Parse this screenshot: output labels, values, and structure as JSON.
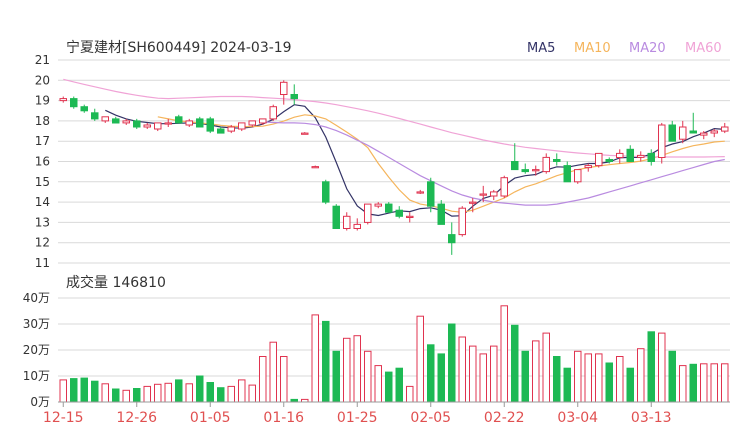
{
  "header": {
    "title": "宁夏建材[SH600449] 2024-03-19",
    "ma_legend": [
      {
        "label": "MA5",
        "color": "#333366"
      },
      {
        "label": "MA10",
        "color": "#f5b55c"
      },
      {
        "label": "MA20",
        "color": "#b98be0"
      },
      {
        "label": "MA60",
        "color": "#f0a3d6"
      }
    ]
  },
  "volume_panel": {
    "label": "成交量 146810"
  },
  "colors": {
    "up": "#e0334f",
    "down": "#1db954",
    "grid": "#d9d9d9",
    "axis_text": "#333333",
    "date_text": "#e05050"
  },
  "chart_data": [
    {
      "type": "candlestick",
      "title": "宁夏建材[SH600449] 2024-03-19",
      "ylim": [
        11,
        21
      ],
      "yticks": [
        "11",
        "12",
        "13",
        "14",
        "15",
        "16",
        "17",
        "18",
        "19",
        "20",
        "21"
      ],
      "x_tick_labels": [
        "12-15",
        "12-26",
        "01-05",
        "01-16",
        "01-25",
        "02-05",
        "02-22",
        "03-04",
        "03-13"
      ],
      "x_tick_index": [
        0,
        7,
        14,
        21,
        28,
        35,
        42,
        49,
        56
      ],
      "ohlc": [
        [
          19.0,
          19.2,
          18.9,
          19.1
        ],
        [
          19.1,
          19.2,
          18.6,
          18.7
        ],
        [
          18.7,
          18.8,
          18.4,
          18.5
        ],
        [
          18.4,
          18.6,
          18.0,
          18.1
        ],
        [
          18.0,
          18.2,
          17.9,
          18.2
        ],
        [
          18.1,
          18.2,
          17.9,
          17.9
        ],
        [
          17.9,
          18.1,
          17.8,
          18.0
        ],
        [
          18.0,
          18.1,
          17.6,
          17.7
        ],
        [
          17.7,
          17.9,
          17.6,
          17.8
        ],
        [
          17.6,
          17.9,
          17.5,
          17.9
        ],
        [
          17.9,
          18.1,
          17.7,
          17.9
        ],
        [
          18.2,
          18.3,
          17.9,
          17.9
        ],
        [
          17.8,
          18.1,
          17.7,
          18.0
        ],
        [
          18.1,
          18.2,
          17.7,
          17.7
        ],
        [
          18.1,
          18.2,
          17.4,
          17.5
        ],
        [
          17.6,
          17.7,
          17.4,
          17.4
        ],
        [
          17.5,
          17.8,
          17.4,
          17.7
        ],
        [
          17.6,
          17.9,
          17.5,
          17.9
        ],
        [
          17.8,
          18.0,
          17.7,
          18.0
        ],
        [
          17.9,
          18.1,
          17.8,
          18.1
        ],
        [
          18.1,
          18.8,
          18.0,
          18.7
        ],
        [
          19.3,
          20.0,
          18.8,
          19.9
        ],
        [
          19.3,
          19.8,
          18.8,
          19.1
        ],
        [
          17.4,
          17.45,
          17.35,
          17.4
        ],
        [
          15.75,
          15.8,
          15.7,
          15.75
        ],
        [
          15.0,
          15.1,
          13.9,
          14.0
        ],
        [
          13.8,
          13.9,
          12.7,
          12.7
        ],
        [
          12.7,
          13.5,
          12.6,
          13.3
        ],
        [
          12.7,
          13.2,
          12.6,
          12.9
        ],
        [
          13.0,
          13.9,
          12.9,
          13.9
        ],
        [
          13.8,
          14.0,
          13.7,
          13.9
        ],
        [
          13.9,
          14.0,
          13.5,
          13.5
        ],
        [
          13.6,
          13.8,
          13.2,
          13.3
        ],
        [
          13.3,
          13.5,
          13.0,
          13.3
        ],
        [
          14.5,
          14.6,
          14.4,
          14.5
        ],
        [
          15.0,
          15.2,
          13.5,
          13.8
        ],
        [
          13.9,
          14.1,
          12.9,
          12.9
        ],
        [
          12.4,
          13.0,
          11.4,
          12.0
        ],
        [
          12.4,
          13.8,
          12.3,
          13.7
        ],
        [
          14.0,
          14.2,
          13.5,
          14.0
        ],
        [
          14.4,
          14.8,
          14.0,
          14.4
        ],
        [
          14.3,
          14.6,
          14.1,
          14.5
        ],
        [
          14.3,
          15.3,
          14.2,
          15.2
        ],
        [
          16.0,
          16.9,
          15.7,
          15.6
        ],
        [
          15.6,
          15.9,
          15.4,
          15.5
        ],
        [
          15.6,
          15.8,
          15.3,
          15.6
        ],
        [
          15.5,
          16.4,
          15.4,
          16.2
        ],
        [
          16.1,
          16.4,
          15.8,
          16.0
        ],
        [
          15.8,
          16.0,
          15.0,
          15.0
        ],
        [
          15.0,
          15.3,
          14.9,
          15.6
        ],
        [
          15.7,
          15.9,
          15.5,
          15.8
        ],
        [
          15.8,
          16.4,
          15.7,
          16.4
        ],
        [
          16.1,
          16.2,
          15.9,
          16.0
        ],
        [
          16.2,
          16.6,
          15.9,
          16.4
        ],
        [
          16.6,
          16.8,
          16.1,
          16.0
        ],
        [
          16.2,
          16.5,
          16.0,
          16.3
        ],
        [
          16.4,
          16.6,
          15.8,
          16.0
        ],
        [
          16.2,
          17.9,
          15.9,
          17.8
        ],
        [
          17.8,
          18.0,
          17.1,
          17.0
        ],
        [
          17.1,
          18.0,
          16.9,
          17.7
        ],
        [
          17.5,
          18.4,
          17.4,
          17.4
        ],
        [
          17.3,
          17.5,
          17.1,
          17.4
        ],
        [
          17.4,
          17.6,
          17.2,
          17.5
        ],
        [
          17.5,
          17.9,
          17.4,
          17.7
        ]
      ],
      "ma_series": [
        {
          "name": "MA5",
          "values": [
            null,
            null,
            null,
            null,
            18.52,
            18.28,
            18.1,
            17.98,
            17.92,
            17.86,
            17.86,
            17.88,
            17.9,
            17.88,
            17.8,
            17.7,
            17.66,
            17.64,
            17.7,
            17.84,
            18.08,
            18.46,
            18.8,
            18.72,
            18.16,
            17.2,
            15.95,
            14.65,
            13.81,
            13.42,
            13.34,
            13.46,
            13.57,
            13.53,
            13.68,
            13.72,
            13.6,
            13.31,
            13.33,
            13.8,
            14.18,
            14.34,
            14.82,
            15.18,
            15.3,
            15.36,
            15.58,
            15.74,
            15.72,
            15.82,
            15.9,
            15.9,
            15.98,
            16.18,
            16.2,
            16.2,
            16.37,
            16.68,
            16.86,
            16.98,
            17.22,
            17.4,
            17.62,
            17.58
          ]
        },
        {
          "name": "MA10",
          "values": [
            null,
            null,
            null,
            null,
            null,
            null,
            null,
            null,
            null,
            18.2,
            18.1,
            18.0,
            17.95,
            17.9,
            17.85,
            17.78,
            17.74,
            17.72,
            17.72,
            17.74,
            17.84,
            17.99,
            18.18,
            18.3,
            18.24,
            18.1,
            17.78,
            17.45,
            17.1,
            16.68,
            15.9,
            15.22,
            14.6,
            14.1,
            13.9,
            13.82,
            13.7,
            13.55,
            13.5,
            13.6,
            13.8,
            14.0,
            14.2,
            14.5,
            14.75,
            14.9,
            15.1,
            15.3,
            15.45,
            15.6,
            15.7,
            15.78,
            15.84,
            15.9,
            15.95,
            16.02,
            16.14,
            16.3,
            16.48,
            16.64,
            16.78,
            16.86,
            16.96,
            17.0
          ]
        },
        {
          "name": "MA20",
          "values": [
            null,
            null,
            null,
            null,
            null,
            null,
            null,
            null,
            null,
            null,
            null,
            null,
            null,
            null,
            null,
            null,
            null,
            null,
            null,
            17.95,
            17.92,
            17.9,
            17.9,
            17.88,
            17.82,
            17.7,
            17.52,
            17.3,
            17.05,
            16.8,
            16.5,
            16.2,
            15.9,
            15.6,
            15.3,
            15.05,
            14.8,
            14.55,
            14.35,
            14.2,
            14.1,
            14.0,
            13.95,
            13.9,
            13.85,
            13.85,
            13.85,
            13.9,
            14.0,
            14.1,
            14.2,
            14.35,
            14.5,
            14.65,
            14.8,
            14.95,
            15.1,
            15.25,
            15.4,
            15.55,
            15.7,
            15.85,
            16.0,
            16.1
          ]
        },
        {
          "name": "MA60",
          "values": [
            20.05,
            19.92,
            19.8,
            19.68,
            19.56,
            19.45,
            19.35,
            19.26,
            19.18,
            19.12,
            19.1,
            19.12,
            19.14,
            19.16,
            19.18,
            19.2,
            19.2,
            19.2,
            19.18,
            19.15,
            19.12,
            19.09,
            19.05,
            19.0,
            18.95,
            18.88,
            18.8,
            18.7,
            18.6,
            18.5,
            18.38,
            18.25,
            18.12,
            17.98,
            17.84,
            17.7,
            17.56,
            17.42,
            17.3,
            17.18,
            17.06,
            16.96,
            16.86,
            16.78,
            16.7,
            16.64,
            16.58,
            16.52,
            16.47,
            16.42,
            16.38,
            16.34,
            16.3,
            16.28,
            16.26,
            16.24,
            16.23,
            16.22,
            16.22,
            16.22,
            16.22,
            16.22,
            16.23,
            16.24
          ]
        }
      ]
    },
    {
      "type": "bar",
      "title": "成交量 146810",
      "ylim": [
        0,
        400000
      ],
      "yticks": [
        "0万",
        "10万",
        "20万",
        "30万",
        "40万"
      ],
      "values": [
        85000,
        90000,
        92000,
        80000,
        70000,
        50000,
        45000,
        52000,
        60000,
        68000,
        72000,
        85000,
        70000,
        100000,
        75000,
        55000,
        60000,
        85000,
        65000,
        175000,
        230000,
        175000,
        10000,
        10000,
        335000,
        310000,
        195000,
        245000,
        255000,
        195000,
        140000,
        115000,
        130000,
        60000,
        330000,
        220000,
        185000,
        300000,
        250000,
        215000,
        185000,
        215000,
        370000,
        295000,
        195000,
        235000,
        265000,
        175000,
        130000,
        195000,
        185000,
        185000,
        150000,
        175000,
        130000,
        205000,
        270000,
        265000,
        195000,
        140000,
        145000,
        146810,
        146810,
        146810
      ]
    }
  ]
}
